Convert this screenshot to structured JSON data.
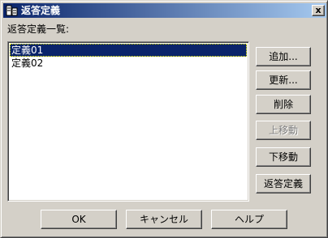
{
  "window": {
    "title": "返答定義",
    "close_label": "x",
    "icon": "app-icon"
  },
  "list": {
    "label": "返答定義一覧:",
    "items": [
      {
        "label": "定義01",
        "selected": true
      },
      {
        "label": "定義02",
        "selected": false
      }
    ]
  },
  "side_buttons": {
    "add": "追加...",
    "update": "更新...",
    "delete": "削除",
    "move_up": "上移動",
    "move_down": "下移動",
    "define_reply": "返答定義"
  },
  "bottom_buttons": {
    "ok": "OK",
    "cancel": "キャンセル",
    "help": "ヘルプ"
  },
  "colors": {
    "titlebar_start": "#0a246a",
    "titlebar_end": "#a6caf0",
    "selection": "#0a246a",
    "face": "#d4d0c8"
  }
}
